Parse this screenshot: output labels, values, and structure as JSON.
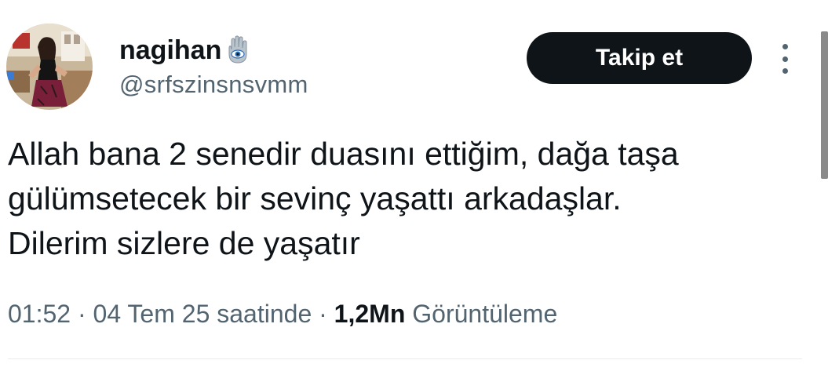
{
  "user": {
    "display_name": "nagihan",
    "handle": "@srfszinsnsvmm",
    "name_emoji_icon": "hamsa-icon"
  },
  "actions": {
    "follow_label": "Takip et",
    "more_icon": "more-vertical-icon"
  },
  "tweet": {
    "text": "Allah bana 2 senedir duasını ettiğim, dağa taşa\ngülümsetecek bir sevinç yaşattı arkadaşlar.\nDilerim sizlere de yaşatır"
  },
  "meta": {
    "time": "01:52",
    "separator": " · ",
    "date": "04 Tem 25 saatinde",
    "views_count": "1,2Mn",
    "views_label": "Görüntüleme"
  },
  "colors": {
    "text_primary": "#0f1419",
    "text_secondary": "#536471",
    "button_bg": "#0f1419",
    "button_text": "#ffffff"
  }
}
